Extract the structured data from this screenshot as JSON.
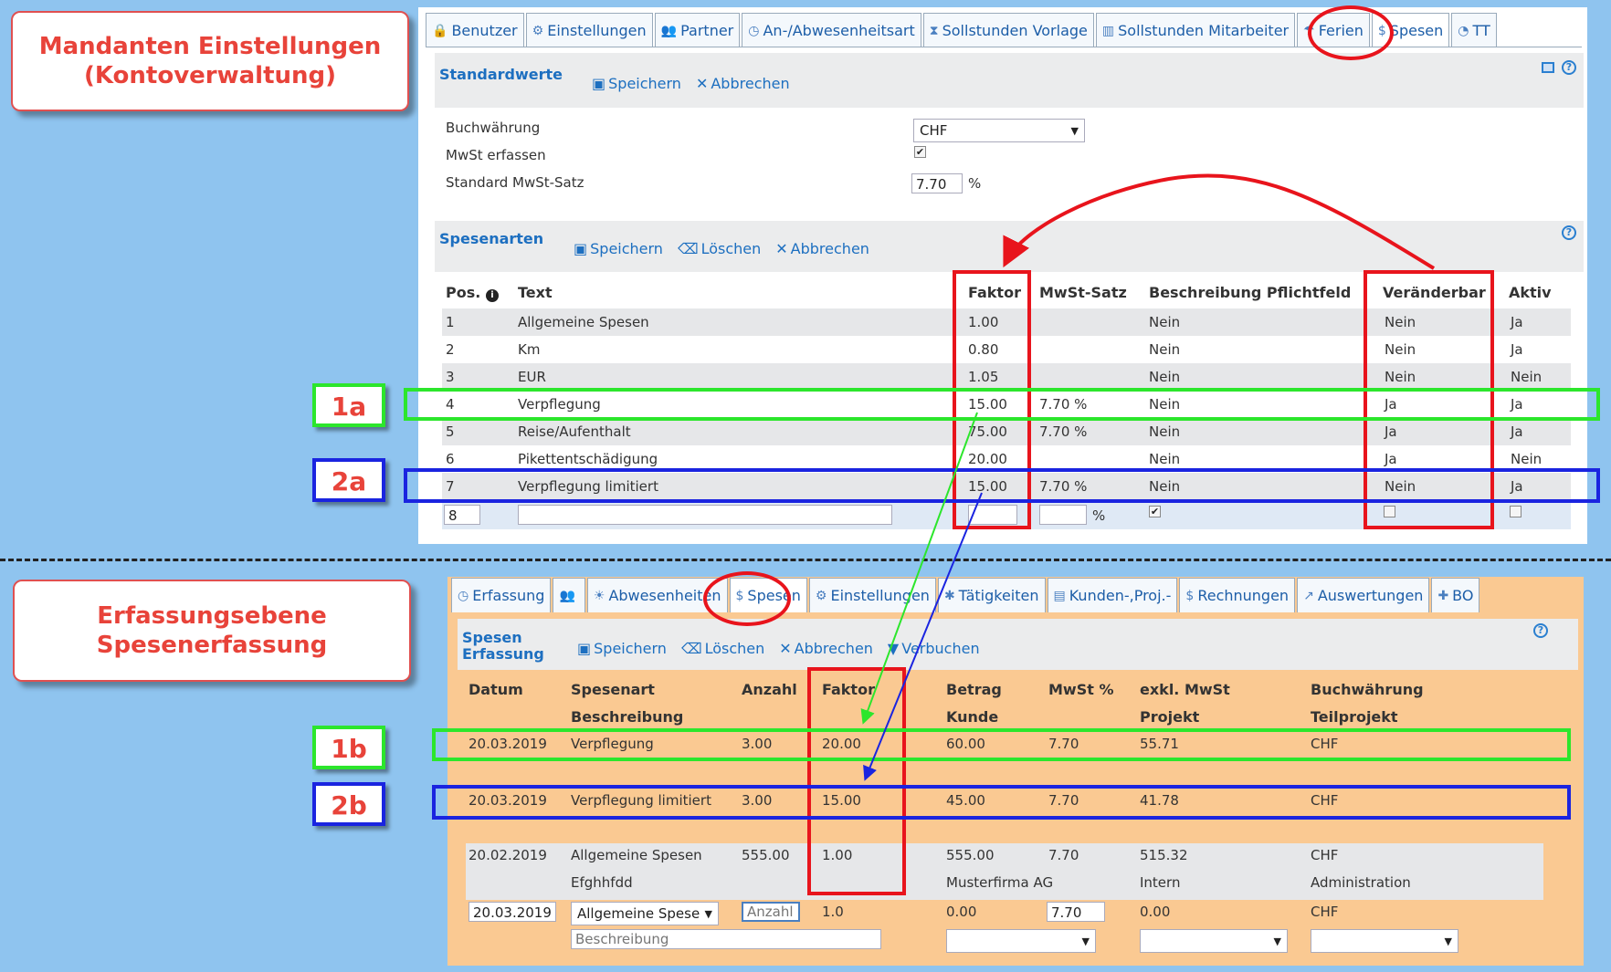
{
  "callouts": {
    "top_line1": "Mandanten Einstellungen",
    "top_line2": "(Kontoverwaltung)",
    "bottom_line1": "Erfassungsebene",
    "bottom_line2": "Spesenerfassung"
  },
  "tags": {
    "t1a": "1a",
    "t2a": "2a",
    "t1b": "1b",
    "t2b": "2b"
  },
  "top_tabs": [
    {
      "label": "Benutzer",
      "icon": "lock-icon"
    },
    {
      "label": "Einstellungen",
      "icon": "gear-icon"
    },
    {
      "label": "Partner",
      "icon": "users-icon"
    },
    {
      "label": "An-/Abwesenheitsart",
      "icon": "clock-icon"
    },
    {
      "label": "Sollstunden Vorlage",
      "icon": "hourglass-icon"
    },
    {
      "label": "Sollstunden Mitarbeiter",
      "icon": "bar-chart-icon"
    },
    {
      "label": "Ferien",
      "icon": "beach-icon"
    },
    {
      "label": "Spesen",
      "icon": "money-icon"
    },
    {
      "label": "TT",
      "icon": "pie-icon"
    }
  ],
  "standard": {
    "title": "Standardwerte",
    "save": "Speichern",
    "cancel": "Abbrechen",
    "currency_label": "Buchwährung",
    "currency_value": "CHF",
    "vat_label": "MwSt erfassen",
    "vat_rate_label": "Standard MwSt-Satz",
    "vat_rate_value": "7.70",
    "percent": "%"
  },
  "spesenarten": {
    "title": "Spesenarten",
    "save": "Speichern",
    "delete": "Löschen",
    "cancel": "Abbrechen",
    "headers": {
      "pos": "Pos.",
      "text": "Text",
      "faktor": "Faktor",
      "mwst": "MwSt-Satz",
      "beschreibung": "Beschreibung Pflichtfeld",
      "veraenderbar": "Veränderbar",
      "aktiv": "Aktiv"
    },
    "rows": [
      {
        "pos": "1",
        "text": "Allgemeine Spesen",
        "faktor": "1.00",
        "mwst": "",
        "beschreibung": "Nein",
        "veraenderbar": "Nein",
        "aktiv": "Ja"
      },
      {
        "pos": "2",
        "text": "Km",
        "faktor": "0.80",
        "mwst": "",
        "beschreibung": "Nein",
        "veraenderbar": "Nein",
        "aktiv": "Ja"
      },
      {
        "pos": "3",
        "text": "EUR",
        "faktor": "1.05",
        "mwst": "",
        "beschreibung": "Nein",
        "veraenderbar": "Nein",
        "aktiv": "Nein"
      },
      {
        "pos": "4",
        "text": "Verpflegung",
        "faktor": "15.00",
        "mwst": "7.70 %",
        "beschreibung": "Nein",
        "veraenderbar": "Ja",
        "aktiv": "Ja"
      },
      {
        "pos": "5",
        "text": "Reise/Aufenthalt",
        "faktor": "75.00",
        "mwst": "7.70 %",
        "beschreibung": "Nein",
        "veraenderbar": "Ja",
        "aktiv": "Ja"
      },
      {
        "pos": "6",
        "text": "Pikettentschädigung",
        "faktor": "20.00",
        "mwst": "",
        "beschreibung": "Nein",
        "veraenderbar": "Ja",
        "aktiv": "Nein"
      },
      {
        "pos": "7",
        "text": "Verpflegung limitiert",
        "faktor": "15.00",
        "mwst": "7.70 %",
        "beschreibung": "Nein",
        "veraenderbar": "Nein",
        "aktiv": "Ja"
      }
    ],
    "new_pos": "8",
    "percent": "%"
  },
  "bottom_tabs": [
    {
      "label": "Erfassung",
      "icon": "clock-icon"
    },
    {
      "label": "",
      "icon": "users-icon"
    },
    {
      "label": "Abwesenheiten",
      "icon": "sun-icon"
    },
    {
      "label": "Spesen",
      "icon": "money-icon"
    },
    {
      "label": "Einstellungen",
      "icon": "gear-icon"
    },
    {
      "label": "Tätigkeiten",
      "icon": "star-icon"
    },
    {
      "label": "Kunden-,Proj.-",
      "icon": "briefcase-icon"
    },
    {
      "label": "Rechnungen",
      "icon": "money-icon"
    },
    {
      "label": "Auswertungen",
      "icon": "line-chart-icon"
    },
    {
      "label": "BO",
      "icon": "puzzle-icon"
    }
  ],
  "erfassung": {
    "title1": "Spesen",
    "title2": "Erfassung",
    "save": "Speichern",
    "delete": "Löschen",
    "cancel": "Abbrechen",
    "book": "Verbuchen",
    "headers": {
      "datum": "Datum",
      "spesenart": "Spesenart",
      "beschreibung": "Beschreibung",
      "anzahl": "Anzahl",
      "faktor": "Faktor",
      "betrag": "Betrag",
      "kunde": "Kunde",
      "mwst": "MwSt %",
      "exkl": "exkl. MwSt",
      "projekt": "Projekt",
      "waehrung": "Buchwährung",
      "teilprojekt": "Teilprojekt"
    },
    "rows": [
      {
        "datum": "20.03.2019",
        "spesenart": "Verpflegung",
        "beschreibung": "",
        "anzahl": "3.00",
        "faktor": "20.00",
        "betrag": "60.00",
        "kunde": "",
        "mwst": "7.70",
        "exkl": "55.71",
        "projekt": "",
        "waehrung": "CHF",
        "teilprojekt": ""
      },
      {
        "datum": "20.03.2019",
        "spesenart": "Verpflegung limitiert",
        "beschreibung": "",
        "anzahl": "3.00",
        "faktor": "15.00",
        "betrag": "45.00",
        "kunde": "",
        "mwst": "7.70",
        "exkl": "41.78",
        "projekt": "",
        "waehrung": "CHF",
        "teilprojekt": ""
      },
      {
        "datum": "20.02.2019",
        "spesenart": "Allgemeine Spesen",
        "beschreibung": "Efghhfdd",
        "anzahl": "555.00",
        "faktor": "1.00",
        "betrag": "555.00",
        "kunde": "Musterfirma AG",
        "mwst": "7.70",
        "exkl": "515.32",
        "projekt": "Intern",
        "waehrung": "CHF",
        "teilprojekt": "Administration"
      }
    ],
    "new_row": {
      "datum": "20.03.2019",
      "spesenart": "Allgemeine Spese",
      "anzahl_placeholder": "Anzahl",
      "faktor": "1.0",
      "betrag": "0.00",
      "mwst": "7.70",
      "exkl": "0.00",
      "waehrung": "CHF",
      "beschreibung_placeholder": "Beschreibung"
    }
  }
}
